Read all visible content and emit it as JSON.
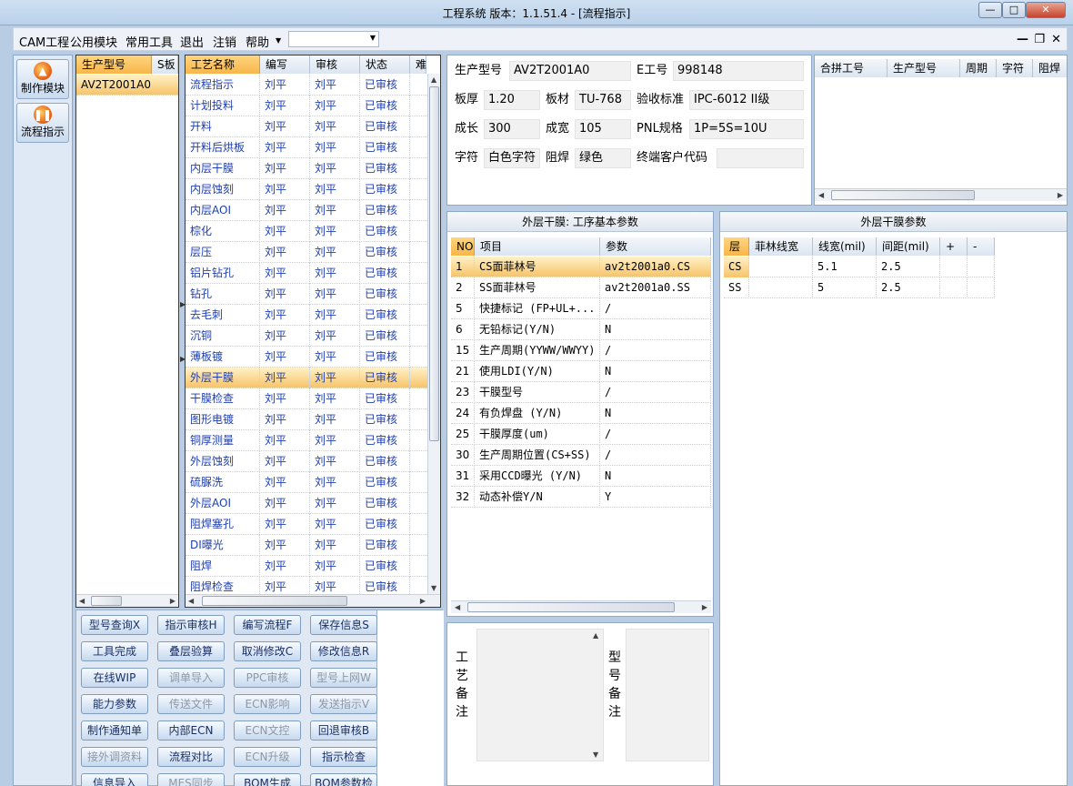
{
  "window": {
    "title": "工程系统   版本：1.1.51.4 - [流程指示]"
  },
  "menu": {
    "items": [
      "CAM工程",
      "公用模块",
      "常用工具",
      "退出",
      "注销",
      "帮助"
    ],
    "combo_value": ""
  },
  "left_nav": [
    {
      "label": "制作模块",
      "icon": "flame-icon"
    },
    {
      "label": "流程指示",
      "icon": "pause-icon"
    }
  ],
  "models": {
    "headers": [
      "生产型号",
      "S板"
    ],
    "rows": [
      "AV2T2001A0"
    ]
  },
  "process": {
    "headers": [
      "工艺名称",
      "编写",
      "审核",
      "状态",
      "难"
    ],
    "rows": [
      {
        "name": "流程指示",
        "writer": "刘平",
        "reviewer": "刘平",
        "status": "已审核"
      },
      {
        "name": "计划投料",
        "writer": "刘平",
        "reviewer": "刘平",
        "status": "已审核"
      },
      {
        "name": "开料",
        "writer": "刘平",
        "reviewer": "刘平",
        "status": "已审核"
      },
      {
        "name": "开料后烘板",
        "writer": "刘平",
        "reviewer": "刘平",
        "status": "已审核"
      },
      {
        "name": "内层干膜",
        "writer": "刘平",
        "reviewer": "刘平",
        "status": "已审核"
      },
      {
        "name": "内层蚀刻",
        "writer": "刘平",
        "reviewer": "刘平",
        "status": "已审核"
      },
      {
        "name": "内层AOI",
        "writer": "刘平",
        "reviewer": "刘平",
        "status": "已审核"
      },
      {
        "name": "棕化",
        "writer": "刘平",
        "reviewer": "刘平",
        "status": "已审核"
      },
      {
        "name": "层压",
        "writer": "刘平",
        "reviewer": "刘平",
        "status": "已审核"
      },
      {
        "name": "铝片钻孔",
        "writer": "刘平",
        "reviewer": "刘平",
        "status": "已审核"
      },
      {
        "name": "钻孔",
        "writer": "刘平",
        "reviewer": "刘平",
        "status": "已审核"
      },
      {
        "name": "去毛刺",
        "writer": "刘平",
        "reviewer": "刘平",
        "status": "已审核"
      },
      {
        "name": "沉铜",
        "writer": "刘平",
        "reviewer": "刘平",
        "status": "已审核"
      },
      {
        "name": "薄板镀",
        "writer": "刘平",
        "reviewer": "刘平",
        "status": "已审核"
      },
      {
        "name": "外层干膜",
        "writer": "刘平",
        "reviewer": "刘平",
        "status": "已审核"
      },
      {
        "name": "干膜检查",
        "writer": "刘平",
        "reviewer": "刘平",
        "status": "已审核"
      },
      {
        "name": "图形电镀",
        "writer": "刘平",
        "reviewer": "刘平",
        "status": "已审核"
      },
      {
        "name": "铜厚测量",
        "writer": "刘平",
        "reviewer": "刘平",
        "status": "已审核"
      },
      {
        "name": "外层蚀刻",
        "writer": "刘平",
        "reviewer": "刘平",
        "status": "已审核"
      },
      {
        "name": "硫脲洗",
        "writer": "刘平",
        "reviewer": "刘平",
        "status": "已审核"
      },
      {
        "name": "外层AOI",
        "writer": "刘平",
        "reviewer": "刘平",
        "status": "已审核"
      },
      {
        "name": "阻焊塞孔",
        "writer": "刘平",
        "reviewer": "刘平",
        "status": "已审核"
      },
      {
        "name": "DI曝光",
        "writer": "刘平",
        "reviewer": "刘平",
        "status": "已审核"
      },
      {
        "name": "阻焊",
        "writer": "刘平",
        "reviewer": "刘平",
        "status": "已审核"
      },
      {
        "name": "阻焊检查",
        "writer": "刘平",
        "reviewer": "刘平",
        "status": "已审核"
      }
    ],
    "selected_index": 14
  },
  "info": {
    "model_label": "生产型号",
    "model_value": "AV2T2001A0",
    "eno_label": "E工号",
    "eno_value": "998148",
    "thickness_label": "板厚",
    "thickness_value": "1.20",
    "material_label": "板材",
    "material_value": "TU-768",
    "standard_label": "验收标准",
    "standard_value": "IPC-6012 II级",
    "length_label": "成长",
    "length_value": "300",
    "width_label": "成宽",
    "width_value": "105",
    "pnl_label": "PNL规格",
    "pnl_value": "1P=5S=10U",
    "char_label": "字符",
    "char_value": "白色字符",
    "solder_label": "阻焊",
    "solder_value": "绿色",
    "customer_label": "终端客户代码",
    "customer_value": ""
  },
  "combine": {
    "headers": [
      "合拼工号",
      "生产型号",
      "周期",
      "字符",
      "阻焊"
    ]
  },
  "basic_params": {
    "title": "外层干膜: 工序基本参数",
    "headers": [
      "NO",
      "项目",
      "参数"
    ],
    "rows": [
      {
        "no": "1",
        "item": "CS面菲林号",
        "value": "av2t2001a0.CS"
      },
      {
        "no": "2",
        "item": "SS面菲林号",
        "value": "av2t2001a0.SS"
      },
      {
        "no": "5",
        "item": "快捷标记 (FP+UL+...",
        "value": "/"
      },
      {
        "no": "6",
        "item": "无铅标记(Y/N)",
        "value": "N"
      },
      {
        "no": "15",
        "item": "生产周期(YYWW/WWYY)",
        "value": "/"
      },
      {
        "no": "21",
        "item": "使用LDI(Y/N)",
        "value": "N"
      },
      {
        "no": "23",
        "item": "干膜型号",
        "value": "/"
      },
      {
        "no": "24",
        "item": "有负焊盘 (Y/N)",
        "value": "N"
      },
      {
        "no": "25",
        "item": "干膜厚度(um)",
        "value": "/"
      },
      {
        "no": "30",
        "item": "生产周期位置(CS+SS)",
        "value": "/"
      },
      {
        "no": "31",
        "item": "采用CCD曝光 (Y/N)",
        "value": "N"
      },
      {
        "no": "32",
        "item": "动态补偿Y/N",
        "value": "Y"
      }
    ]
  },
  "film_params": {
    "title": "外层干膜参数",
    "headers": [
      "层",
      "菲林线宽",
      "线宽(mil)",
      "间距(mil)",
      "+",
      "-"
    ],
    "rows": [
      {
        "layer": "CS",
        "film": "",
        "width": "5.1",
        "space": "2.5"
      },
      {
        "layer": "SS",
        "film": "",
        "width": "5",
        "space": "2.5"
      }
    ]
  },
  "buttons": [
    [
      "型号查询X",
      "指示审核H",
      "编写流程F",
      "保存信息S"
    ],
    [
      "工具完成",
      "叠层验算",
      "取消修改C",
      "修改信息R"
    ],
    [
      "在线WIP",
      "调单导入",
      "PPC审核",
      "型号上网W"
    ],
    [
      "能力参数",
      "传送文件",
      "ECN影响",
      "发送指示V"
    ],
    [
      "制作通知单",
      "内部ECN",
      "ECN文控",
      "回退审核B"
    ],
    [
      "接外调资料",
      "流程对比",
      "ECN升级",
      "指示检查"
    ],
    [
      "信息导入",
      "MES同步",
      "BOM生成",
      "BOM参数检查"
    ]
  ],
  "disabled_buttons": [
    "调单导入",
    "PPC审核",
    "型号上网W",
    "传送文件",
    "ECN影响",
    "发送指示V",
    "ECN文控",
    "接外调资料",
    "ECN升级",
    "MES同步"
  ],
  "remarks": {
    "process_label": "工艺备注",
    "model_label": "型号备注"
  }
}
